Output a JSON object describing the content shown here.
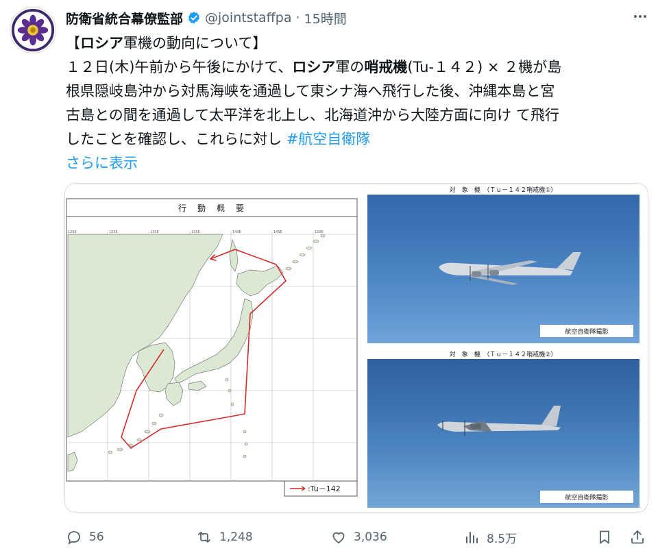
{
  "account": {
    "display_name": "防衛省統合幕僚監部",
    "handle": "@jointstaffpa",
    "separator": "·",
    "time": "15時間"
  },
  "post": {
    "title": "【ロシア軍機の動向について】",
    "body_lines": [
      "１２日(木)午前から午後にかけて、ロシア軍の哨戒機(Tu-１４２) × ２機が島",
      "根県隠岐島沖から対馬海峡を通過して東シナ海へ飛行した後、沖縄本島と宮",
      "古島との間を通過して太平洋を北上し、北海道沖から大陸方面に向け て飛行",
      "したことを確認し、これらに対し "
    ],
    "hashtag": "#航空自衛隊",
    "show_more": "さらに表示"
  },
  "media": {
    "map": {
      "title": "行　動　概　要",
      "legend_label": ":Tu－142",
      "route_color": "#d62b2b",
      "land_color": "#dbe9d3",
      "sea_color": "#ffffff",
      "lon_labels": [
        "120E",
        "125E",
        "130E",
        "135E",
        "140E",
        "145E",
        "150E"
      ]
    },
    "photo_1": {
      "caption": "対　象　機　（Ｔｕ－１４２哨戒機①）",
      "credit": "航空自衛隊撮影"
    },
    "photo_2": {
      "caption": "対　象　機　（Ｔｕ－１４２哨戒機②）",
      "credit": "航空自衛隊撮影"
    }
  },
  "stats": {
    "replies": "56",
    "reposts": "1,248",
    "likes": "3,036",
    "views": "8.5万"
  },
  "colors": {
    "link": "#1d9bf0",
    "muted": "#536471",
    "verified": "#1d9bf0"
  }
}
